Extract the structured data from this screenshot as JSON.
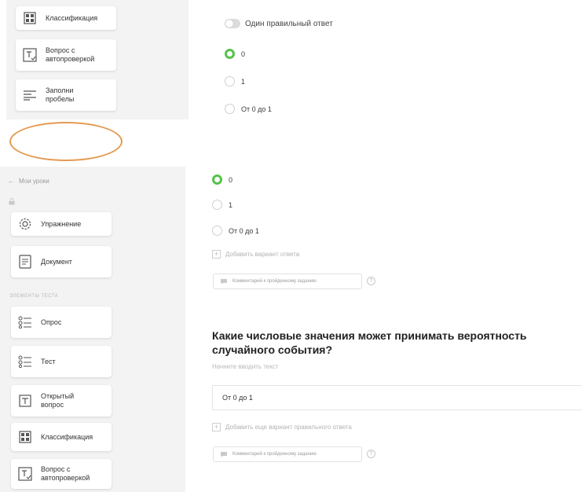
{
  "top_sidebar": {
    "items": [
      {
        "label": "Классификация",
        "icon": "grid-icon"
      },
      {
        "label": "Вопрос с\nавтопроверкой",
        "icon": "text-check-icon"
      },
      {
        "label": "Заполни\nпробелы",
        "icon": "lines-icon"
      }
    ]
  },
  "top_panel": {
    "toggle_label": "Один правильный ответ",
    "options": [
      {
        "label": "0",
        "selected": true
      },
      {
        "label": "1",
        "selected": false
      },
      {
        "label": "От 0 до 1",
        "selected": false
      }
    ]
  },
  "bottom_sidebar": {
    "back_label": "Мои уроки",
    "tools": [
      {
        "label": "Упражнение",
        "icon": "gear-icon"
      },
      {
        "label": "Документ",
        "icon": "document-icon"
      }
    ],
    "section_caption": "ЭЛЕМЕНТЫ ТЕСТА",
    "test_items": [
      {
        "label": "Опрос",
        "icon": "list-icon"
      },
      {
        "label": "Тест",
        "icon": "list-icon"
      },
      {
        "label": "Открытый\nвопрос",
        "icon": "text-box-icon"
      },
      {
        "label": "Классификация",
        "icon": "grid-icon"
      },
      {
        "label": "Вопрос с\nавтопроверкой",
        "icon": "text-check-icon"
      }
    ]
  },
  "bottom_panel": {
    "options": [
      {
        "label": "0",
        "selected": true
      },
      {
        "label": "1",
        "selected": false
      },
      {
        "label": "От 0 до 1",
        "selected": false
      }
    ],
    "add_option_label": "Добавить вариант ответа",
    "comment_label": "Комментарий к пройденному заданию",
    "help_label": "?",
    "question_text": "Какие числовые значения может принимать вероятность случайного события?",
    "question_placeholder": "Начните вводить текст",
    "answer_value": "От 0 до 1",
    "add_correct_label": "Добавить еще вариант правильного ответа",
    "comment_label_2": "Комментарий к пройденному заданию"
  },
  "colors": {
    "accent_green": "#55c24b",
    "annotation_orange": "#e49a52",
    "sidebar_bg": "#f3f3f3"
  }
}
